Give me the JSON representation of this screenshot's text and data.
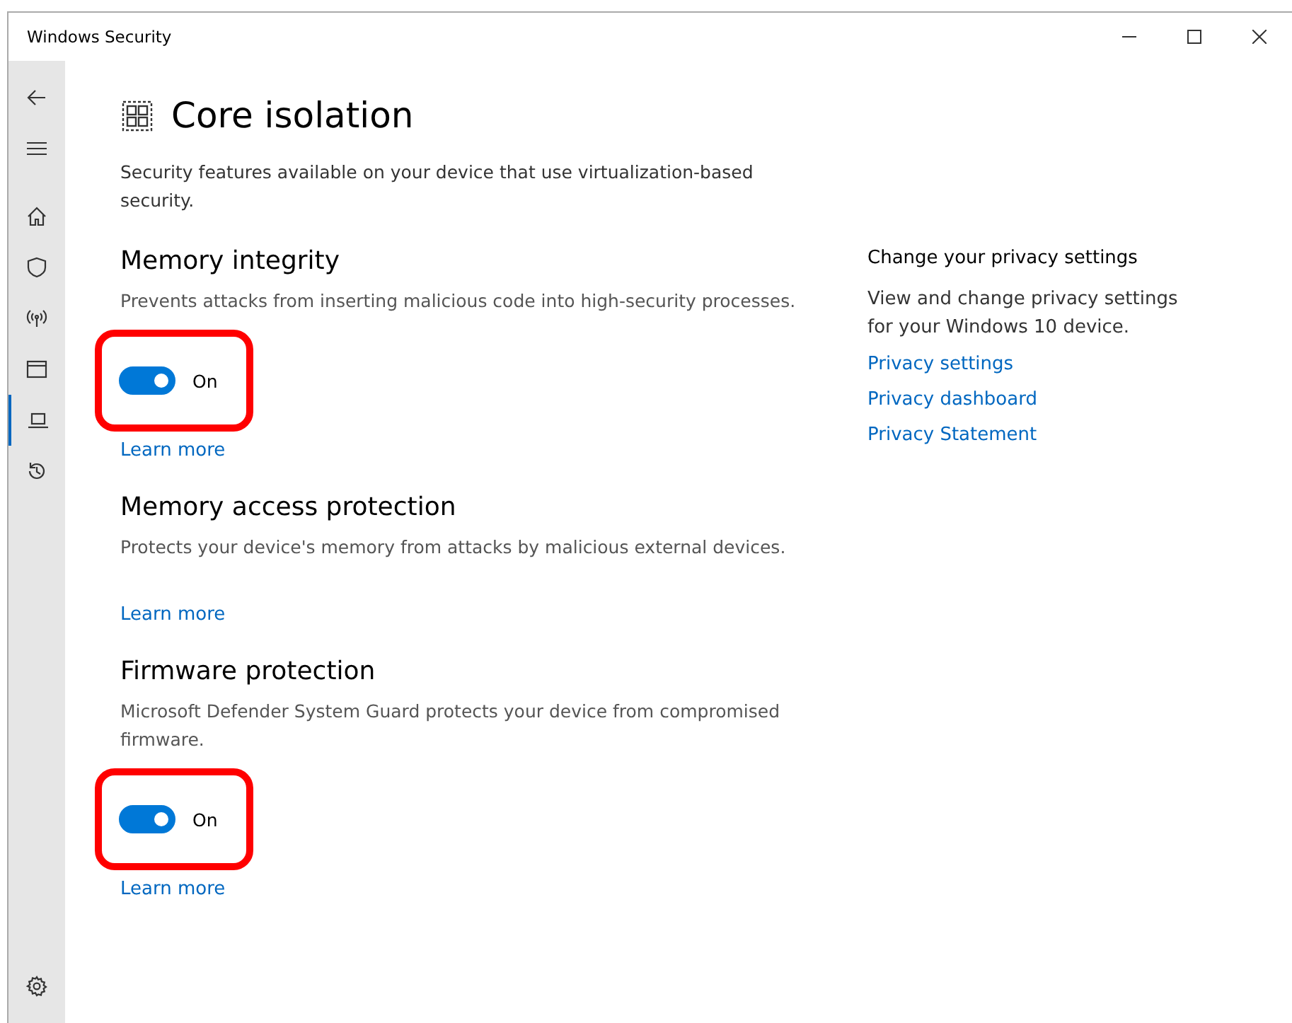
{
  "window": {
    "title": "Windows Security"
  },
  "nav": [
    {
      "selected": false
    },
    {
      "selected": false
    },
    {
      "selected": false
    },
    {
      "selected": false
    },
    {
      "selected": false
    },
    {
      "selected": false
    },
    {
      "selected": true
    },
    {
      "selected": false
    }
  ],
  "settings_icon": true,
  "page": {
    "title": "Core isolation",
    "description": "Security features available on your device that use virtualization-based security."
  },
  "sections": [
    {
      "title": "Memory integrity",
      "description": "Prevents attacks from inserting malicious code into high-security processes.",
      "toggle": {
        "on": true,
        "label": "On"
      },
      "highlighted": true,
      "link": "Learn more"
    },
    {
      "title": "Memory access protection",
      "description": "Protects your device's memory from attacks by malicious external devices.",
      "link": "Learn more"
    },
    {
      "title": "Firmware protection",
      "description": "Microsoft Defender System Guard protects your device from compromised firmware.",
      "toggle": {
        "on": true,
        "label": "On"
      },
      "highlighted": true,
      "link": "Learn more"
    }
  ],
  "privacy": {
    "title": "Change your privacy settings",
    "description": "View and change privacy settings for your Windows 10 device.",
    "links": [
      "Privacy settings",
      "Privacy dashboard",
      "Privacy Statement"
    ]
  }
}
